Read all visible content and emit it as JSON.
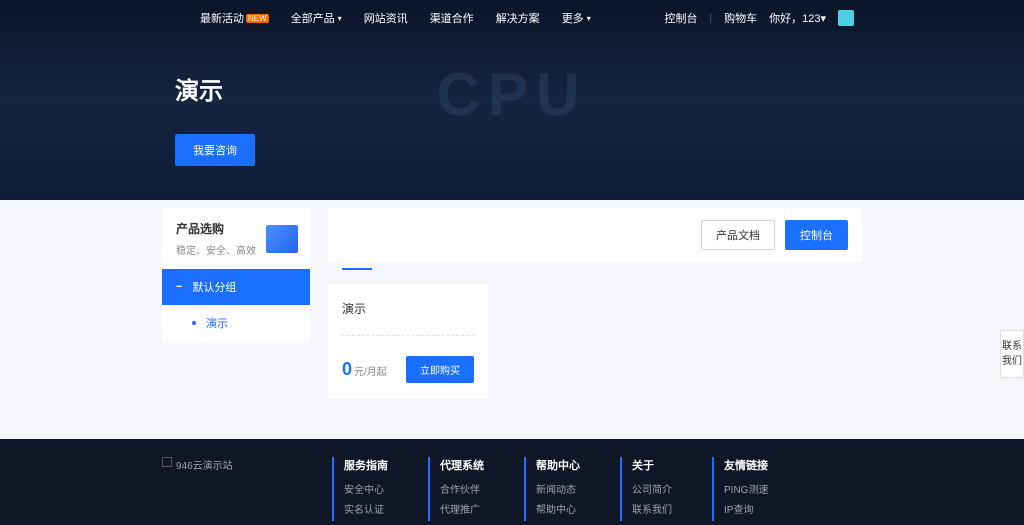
{
  "nav": {
    "items": [
      {
        "label": "最新活动",
        "badge": "NEW"
      },
      {
        "label": "全部产品",
        "chevron": true
      },
      {
        "label": "网站资讯"
      },
      {
        "label": "渠道合作"
      },
      {
        "label": "解决方案"
      },
      {
        "label": "更多",
        "chevron": true
      }
    ],
    "right": {
      "console": "控制台",
      "cart": "购物车",
      "greeting": "你好，123"
    }
  },
  "hero": {
    "title": "演示",
    "cta": "我要咨询",
    "bg_text": "CPU"
  },
  "sidebar": {
    "card_title": "产品选购",
    "card_sub": "稳定、安全、高效",
    "group": "默认分组",
    "item": "演示"
  },
  "content": {
    "doc_btn": "产品文档",
    "console_btn": "控制台"
  },
  "product": {
    "title": "演示",
    "price": "0",
    "unit": "元/月起",
    "buy": "立即购买"
  },
  "side_contact": "联系我们",
  "footer": {
    "logo": "946云演示站",
    "cols": [
      {
        "title": "服务指南",
        "links": [
          "安全中心",
          "实名认证"
        ]
      },
      {
        "title": "代理系统",
        "links": [
          "合作伙伴",
          "代理推广"
        ]
      },
      {
        "title": "帮助中心",
        "links": [
          "新闻动态",
          "帮助中心"
        ]
      },
      {
        "title": "关于",
        "links": [
          "公司简介",
          "联系我们"
        ]
      },
      {
        "title": "友情链接",
        "links": [
          "PING测速",
          "IP查询"
        ]
      }
    ]
  }
}
